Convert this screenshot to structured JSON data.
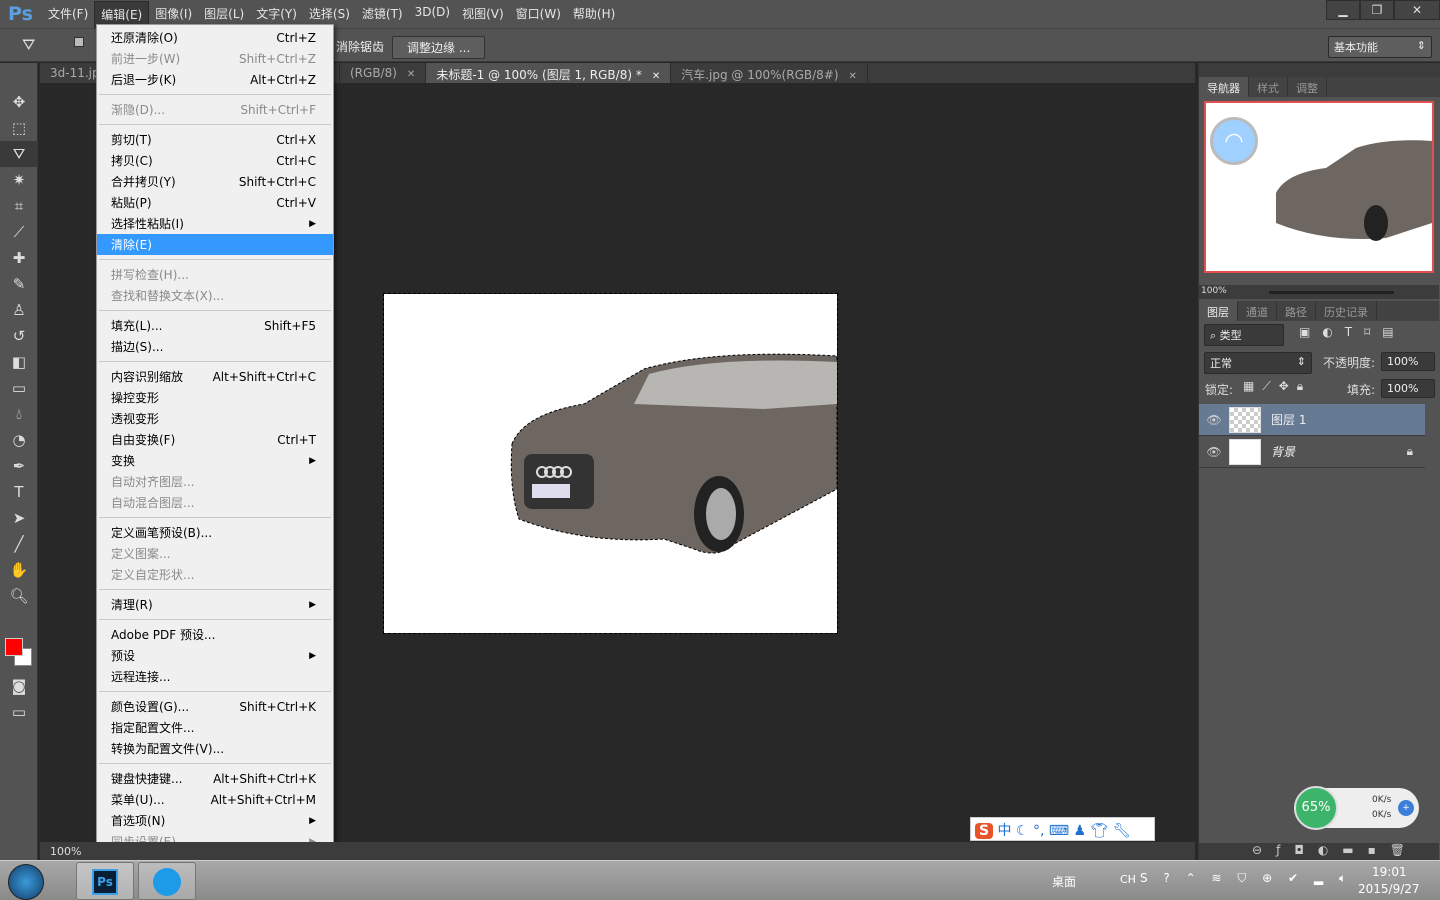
{
  "app": {
    "logo": "Ps"
  },
  "menubar": [
    "文件(F)",
    "编辑(E)",
    "图像(I)",
    "图层(L)",
    "文字(Y)",
    "选择(S)",
    "滤镜(T)",
    "3D(D)",
    "视图(V)",
    "窗口(W)",
    "帮助(H)"
  ],
  "window_controls": {
    "minimize": "▁",
    "restore": "❐",
    "close": "✕"
  },
  "options": {
    "antialias": "消除锯齿",
    "refine_edge": "调整边缘 ...",
    "workspace": "基本功能"
  },
  "tabs": [
    {
      "label": "3d-11.jp"
    },
    {
      "label": "(RGB/8)"
    },
    {
      "label": "未标题-1 @ 100% (图层 1, RGB/8) *",
      "active": true
    },
    {
      "label": "汽车.jpg @ 100%(RGB/8#)"
    }
  ],
  "tools": [
    "move-icon",
    "marquee-icon",
    "polygon-lasso-icon",
    "magic-wand-icon",
    "crop-icon",
    "eyedropper-icon",
    "healing-brush-icon",
    "brush-icon",
    "clone-stamp-icon",
    "history-brush-icon",
    "eraser-icon",
    "gradient-icon",
    "blur-icon",
    "dodge-icon",
    "pen-icon",
    "type-icon",
    "path-select-icon",
    "line-icon",
    "hand-icon",
    "zoom-icon"
  ],
  "colors": {
    "foreground": "#ff0000",
    "background": "#ffffff",
    "highlight": "#3399ff",
    "layer_selected": "#667a93"
  },
  "status": {
    "zoom": "100%"
  },
  "edit_menu": [
    {
      "label": "还原清除(O)",
      "shortcut": "Ctrl+Z"
    },
    {
      "label": "前进一步(W)",
      "shortcut": "Shift+Ctrl+Z",
      "disabled": true
    },
    {
      "label": "后退一步(K)",
      "shortcut": "Alt+Ctrl+Z"
    },
    {
      "sep": true
    },
    {
      "label": "渐隐(D)...",
      "shortcut": "Shift+Ctrl+F",
      "disabled": true
    },
    {
      "sep": true
    },
    {
      "label": "剪切(T)",
      "shortcut": "Ctrl+X"
    },
    {
      "label": "拷贝(C)",
      "shortcut": "Ctrl+C"
    },
    {
      "label": "合并拷贝(Y)",
      "shortcut": "Shift+Ctrl+C"
    },
    {
      "label": "粘贴(P)",
      "shortcut": "Ctrl+V"
    },
    {
      "label": "选择性粘贴(I)",
      "submenu": true
    },
    {
      "label": "清除(E)",
      "highlighted": true
    },
    {
      "sep": true
    },
    {
      "label": "拼写检查(H)...",
      "disabled": true
    },
    {
      "label": "查找和替换文本(X)...",
      "disabled": true
    },
    {
      "sep": true
    },
    {
      "label": "填充(L)...",
      "shortcut": "Shift+F5"
    },
    {
      "label": "描边(S)..."
    },
    {
      "sep": true
    },
    {
      "label": "内容识别缩放",
      "shortcut": "Alt+Shift+Ctrl+C"
    },
    {
      "label": "操控变形"
    },
    {
      "label": "透视变形"
    },
    {
      "label": "自由变换(F)",
      "shortcut": "Ctrl+T"
    },
    {
      "label": "变换",
      "submenu": true
    },
    {
      "label": "自动对齐图层...",
      "disabled": true
    },
    {
      "label": "自动混合图层...",
      "disabled": true
    },
    {
      "sep": true
    },
    {
      "label": "定义画笔预设(B)..."
    },
    {
      "label": "定义图案...",
      "disabled": true
    },
    {
      "label": "定义自定形状...",
      "disabled": true
    },
    {
      "sep": true
    },
    {
      "label": "清理(R)",
      "submenu": true
    },
    {
      "sep": true
    },
    {
      "label": "Adobe PDF 预设..."
    },
    {
      "label": "预设",
      "submenu": true
    },
    {
      "label": "远程连接..."
    },
    {
      "sep": true
    },
    {
      "label": "颜色设置(G)...",
      "shortcut": "Shift+Ctrl+K"
    },
    {
      "label": "指定配置文件..."
    },
    {
      "label": "转换为配置文件(V)..."
    },
    {
      "sep": true
    },
    {
      "label": "键盘快捷键...",
      "shortcut": "Alt+Shift+Ctrl+K"
    },
    {
      "label": "菜单(U)...",
      "shortcut": "Alt+Shift+Ctrl+M"
    },
    {
      "label": "首选项(N)",
      "submenu": true
    },
    {
      "label": "同步设置(E)",
      "submenu": true,
      "disabled": true
    }
  ],
  "navigator": {
    "tabs": [
      "导航器",
      "样式",
      "调整"
    ],
    "zoom": "100%"
  },
  "layers": {
    "tabs": [
      "图层",
      "通道",
      "路径",
      "历史记录"
    ],
    "filter": "类型",
    "blend_mode": "正常",
    "opacity_label": "不透明度:",
    "opacity": "100%",
    "lock_label": "锁定:",
    "fill_label": "填充:",
    "fill": "100%",
    "items": [
      {
        "name": "图层 1",
        "selected": true,
        "visible": true
      },
      {
        "name": "背景",
        "locked": true,
        "visible": true
      }
    ]
  },
  "ime": {
    "mode": "中"
  },
  "netmon": {
    "percent": "65%",
    "up": "0K/s",
    "down": "0K/s"
  },
  "taskbar": {
    "desktop": "桌面",
    "lang": "CH",
    "time": "19:01",
    "date": "2015/9/27"
  }
}
